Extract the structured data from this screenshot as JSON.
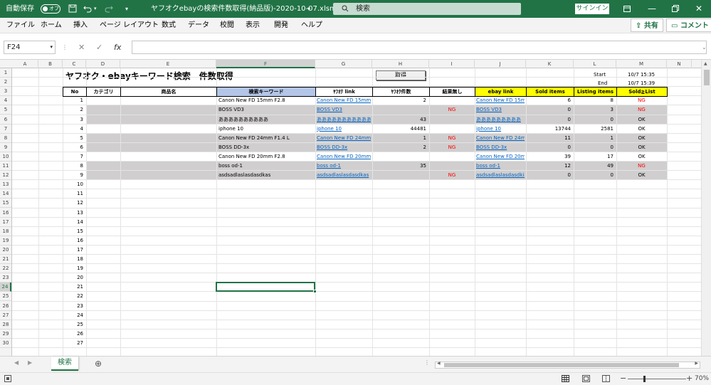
{
  "titlebar": {
    "autosave_label": "自動保存",
    "autosave_state": "オフ",
    "filename": "ヤフオクebayの検索件数取得(納品版)-2020-10-07.xlsm",
    "search_placeholder": "検索",
    "signin_label": "サインイン"
  },
  "menu": [
    "ファイル",
    "ホーム",
    "挿入",
    "ページ レイアウト",
    "数式",
    "データ",
    "校閲",
    "表示",
    "開発",
    "ヘルプ"
  ],
  "share_label": "共有",
  "comment_label": "コメント",
  "namebox": "F24",
  "formula": "",
  "columns": [
    "A",
    "B",
    "C",
    "D",
    "E",
    "F",
    "G",
    "H",
    "I",
    "J",
    "K",
    "L",
    "M",
    "N"
  ],
  "selected_column": "F",
  "selected_row": "24",
  "rows": [
    "1",
    "2",
    "3",
    "4",
    "5",
    "6",
    "7",
    "8",
    "9",
    "10",
    "11",
    "12",
    "13",
    "14",
    "15",
    "16",
    "17",
    "18",
    "19",
    "20",
    "21",
    "22",
    "23",
    "24",
    "25",
    "26",
    "27",
    "28",
    "29",
    "30"
  ],
  "sheet": {
    "title": "ヤフオク・ebayキーワード検索　件数取得",
    "get_button": "取得",
    "start_label": "Start",
    "start_value": "10/7 15:35",
    "end_label": "End",
    "end_value": "10/7 15:39",
    "headers": [
      "No",
      "カテゴリ",
      "商品名",
      "検索キーワード",
      "ﾔﾌｵｸ link",
      "ﾔﾌｵｸ件数",
      "結果無し",
      "ebay link",
      "Sold items",
      "Listing items",
      "Sold≧List"
    ],
    "no_column": [
      "1",
      "2",
      "3",
      "4",
      "5",
      "6",
      "7",
      "8",
      "9",
      "10",
      "11",
      "12",
      "13",
      "14",
      "15",
      "16",
      "17",
      "18",
      "19",
      "20",
      "21",
      "22",
      "23",
      "24",
      "25",
      "26",
      "27"
    ],
    "data_rows": [
      {
        "keyword": "Canon New FD 15mm F2.8",
        "yafuoku_link": "Canon New FD 15mm",
        "yafuoku_count": "2",
        "no_result": "",
        "ebay_link": "Canon New FD 15m",
        "sold": "6",
        "listing": "8",
        "judge": "NG"
      },
      {
        "keyword": "BOSS VD3",
        "yafuoku_link": "BOSS VD3",
        "yafuoku_count": "",
        "no_result": "NG",
        "ebay_link": "BOSS VD3",
        "sold": "0",
        "listing": "3",
        "judge": "NG"
      },
      {
        "keyword": "ああああああああああ",
        "yafuoku_link": "ああああああああああああ",
        "yafuoku_count": "43",
        "no_result": "",
        "ebay_link": "あああああああああ",
        "sold": "0",
        "listing": "0",
        "judge": "OK"
      },
      {
        "keyword": "iphone 10",
        "yafuoku_link": "iphone 10",
        "yafuoku_count": "44481",
        "no_result": "",
        "ebay_link": "iphone 10",
        "sold": "13744",
        "listing": "2581",
        "judge": "OK"
      },
      {
        "keyword": "Canon New FD 24mm F1.4 L",
        "yafuoku_link": "Canon New FD 24mm",
        "yafuoku_count": "1",
        "no_result": "NG",
        "ebay_link": "Canon New FD 24m",
        "sold": "11",
        "listing": "1",
        "judge": "OK"
      },
      {
        "keyword": "BOSS DD-3x",
        "yafuoku_link": "BOSS DD-3x",
        "yafuoku_count": "2",
        "no_result": "NG",
        "ebay_link": "BOSS DD-3x",
        "sold": "0",
        "listing": "0",
        "judge": "OK"
      },
      {
        "keyword": "Canon New FD 20mm F2.8",
        "yafuoku_link": "Canon New FD 20mm",
        "yafuoku_count": "",
        "no_result": "",
        "ebay_link": "Canon New FD 20m",
        "sold": "39",
        "listing": "17",
        "judge": "OK"
      },
      {
        "keyword": "boss od-1",
        "yafuoku_link": "boss od-1",
        "yafuoku_count": "35",
        "no_result": "",
        "ebay_link": "boss od-1",
        "sold": "12",
        "listing": "49",
        "judge": "NG"
      },
      {
        "keyword": "asdsadlaslasdasdkas",
        "yafuoku_link": "asdsadlaslasdasdkas",
        "yafuoku_count": "",
        "no_result": "NG",
        "ebay_link": "asdsadlaslasdasdkia",
        "sold": "0",
        "listing": "0",
        "judge": "OK"
      }
    ]
  },
  "sheet_tab": "検索",
  "zoom": "70%",
  "colors": {
    "excel_green": "#217346",
    "header_blue": "#b4c6e7",
    "header_yellow": "#ffff00",
    "gray_fill": "#d0cece",
    "link_blue": "#0563c1",
    "ng_red": "#ff0000"
  }
}
